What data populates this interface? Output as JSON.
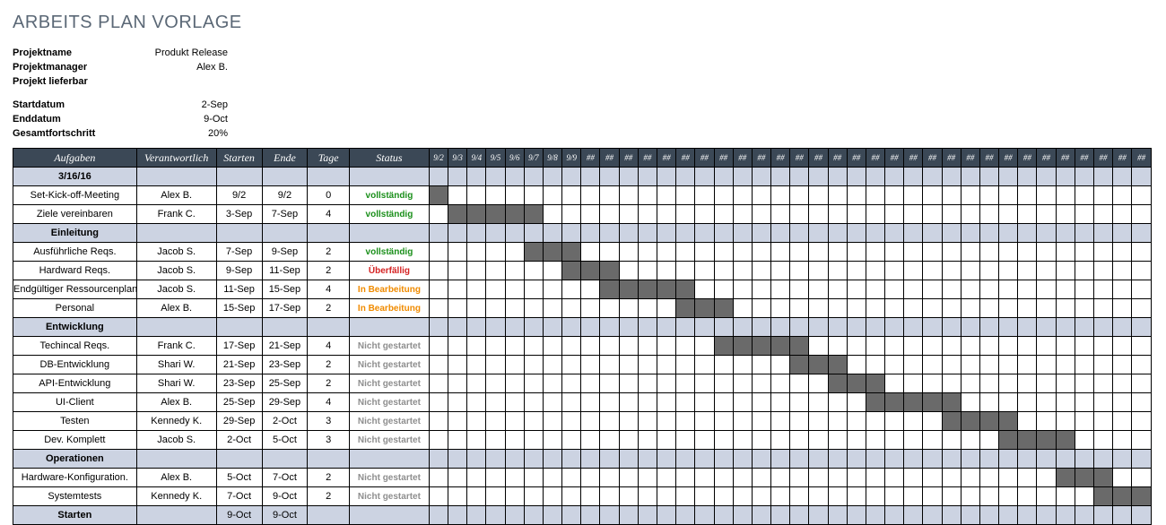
{
  "title": "ARBEITS PLAN VORLAGE",
  "meta": {
    "projektname_l": "Projektname",
    "projektname_v": "Produkt Release",
    "projektmanager_l": "Projektmanager",
    "projektmanager_v": "Alex B.",
    "lieferbar_l": "Projekt lieferbar",
    "lieferbar_v": "",
    "start_l": "Startdatum",
    "start_v": "2-Sep",
    "end_l": "Enddatum",
    "end_v": "9-Oct",
    "progress_l": "Gesamtfortschritt",
    "progress_v": "20%"
  },
  "headers": {
    "task": "Aufgaben",
    "resp": "Verantwortlich",
    "start": "Starten",
    "end": "Ende",
    "days": "Tage",
    "status": "Status"
  },
  "days": [
    "9/2",
    "9/3",
    "9/4",
    "9/5",
    "9/6",
    "9/7",
    "9/8",
    "9/9",
    "##",
    "##",
    "##",
    "##",
    "##",
    "##",
    "##",
    "##",
    "##",
    "##",
    "##",
    "##",
    "##",
    "##",
    "##",
    "##",
    "##",
    "##",
    "##",
    "##",
    "##",
    "##",
    "##",
    "##",
    "##",
    "##",
    "##",
    "##",
    "##",
    "##"
  ],
  "rows": [
    {
      "type": "section",
      "label": "3/16/16"
    },
    {
      "type": "task",
      "task": "Set-Kick-off-Meeting",
      "resp": "Alex B.",
      "start": "9/2",
      "end": "9/2",
      "days": "0",
      "status": "vollständig",
      "sclass": "s-done",
      "bar": [
        0,
        0
      ]
    },
    {
      "type": "task",
      "task": "Ziele vereinbaren",
      "resp": "Frank C.",
      "start": "3-Sep",
      "end": "7-Sep",
      "days": "4",
      "status": "vollständig",
      "sclass": "s-done",
      "bar": [
        1,
        5
      ]
    },
    {
      "type": "section",
      "label": "Einleitung"
    },
    {
      "type": "task",
      "task": "Ausführliche Reqs.",
      "resp": "Jacob S.",
      "start": "7-Sep",
      "end": "9-Sep",
      "days": "2",
      "status": "vollständig",
      "sclass": "s-done",
      "bar": [
        5,
        7
      ]
    },
    {
      "type": "task",
      "task": "Hardward Reqs.",
      "resp": "Jacob S.",
      "start": "9-Sep",
      "end": "11-Sep",
      "days": "2",
      "status": "Überfällig",
      "sclass": "s-over",
      "bar": [
        7,
        9
      ]
    },
    {
      "type": "task",
      "task": "Endgültiger Ressourcenplan",
      "resp": "Jacob S.",
      "start": "11-Sep",
      "end": "15-Sep",
      "days": "4",
      "status": "In Bearbeitung",
      "sclass": "s-prog",
      "bar": [
        9,
        13
      ]
    },
    {
      "type": "task",
      "task": "Personal",
      "resp": "Alex B.",
      "start": "15-Sep",
      "end": "17-Sep",
      "days": "2",
      "status": "In Bearbeitung",
      "sclass": "s-prog",
      "bar": [
        13,
        15
      ]
    },
    {
      "type": "section",
      "label": "Entwicklung"
    },
    {
      "type": "task",
      "task": "Techincal Reqs.",
      "resp": "Frank C.",
      "start": "17-Sep",
      "end": "21-Sep",
      "days": "4",
      "status": "Nicht gestartet",
      "sclass": "s-ns",
      "bar": [
        15,
        19
      ]
    },
    {
      "type": "task",
      "task": "DB-Entwicklung",
      "resp": "Shari W.",
      "start": "21-Sep",
      "end": "23-Sep",
      "days": "2",
      "status": "Nicht gestartet",
      "sclass": "s-ns",
      "bar": [
        19,
        21
      ]
    },
    {
      "type": "task",
      "task": "API-Entwicklung",
      "resp": "Shari W.",
      "start": "23-Sep",
      "end": "25-Sep",
      "days": "2",
      "status": "Nicht gestartet",
      "sclass": "s-ns",
      "bar": [
        21,
        23
      ]
    },
    {
      "type": "task",
      "task": "UI-Client",
      "resp": "Alex B.",
      "start": "25-Sep",
      "end": "29-Sep",
      "days": "4",
      "status": "Nicht gestartet",
      "sclass": "s-ns",
      "bar": [
        23,
        27
      ]
    },
    {
      "type": "task",
      "task": "Testen",
      "resp": "Kennedy K.",
      "start": "29-Sep",
      "end": "2-Oct",
      "days": "3",
      "status": "Nicht gestartet",
      "sclass": "s-ns",
      "bar": [
        27,
        30
      ]
    },
    {
      "type": "task",
      "task": "Dev. Komplett",
      "resp": "Jacob S.",
      "start": "2-Oct",
      "end": "5-Oct",
      "days": "3",
      "status": "Nicht gestartet",
      "sclass": "s-ns",
      "bar": [
        30,
        33
      ]
    },
    {
      "type": "section",
      "label": "Operationen"
    },
    {
      "type": "task",
      "task": "Hardware-Konfiguration.",
      "resp": "Alex B.",
      "start": "5-Oct",
      "end": "7-Oct",
      "days": "2",
      "status": "Nicht gestartet",
      "sclass": "s-ns",
      "bar": [
        33,
        35
      ]
    },
    {
      "type": "task",
      "task": "Systemtests",
      "resp": "Kennedy K.",
      "start": "7-Oct",
      "end": "9-Oct",
      "days": "2",
      "status": "Nicht gestartet",
      "sclass": "s-ns",
      "bar": [
        35,
        37
      ]
    },
    {
      "type": "section",
      "label": "Starten",
      "start": "9-Oct",
      "end": "9-Oct"
    }
  ]
}
